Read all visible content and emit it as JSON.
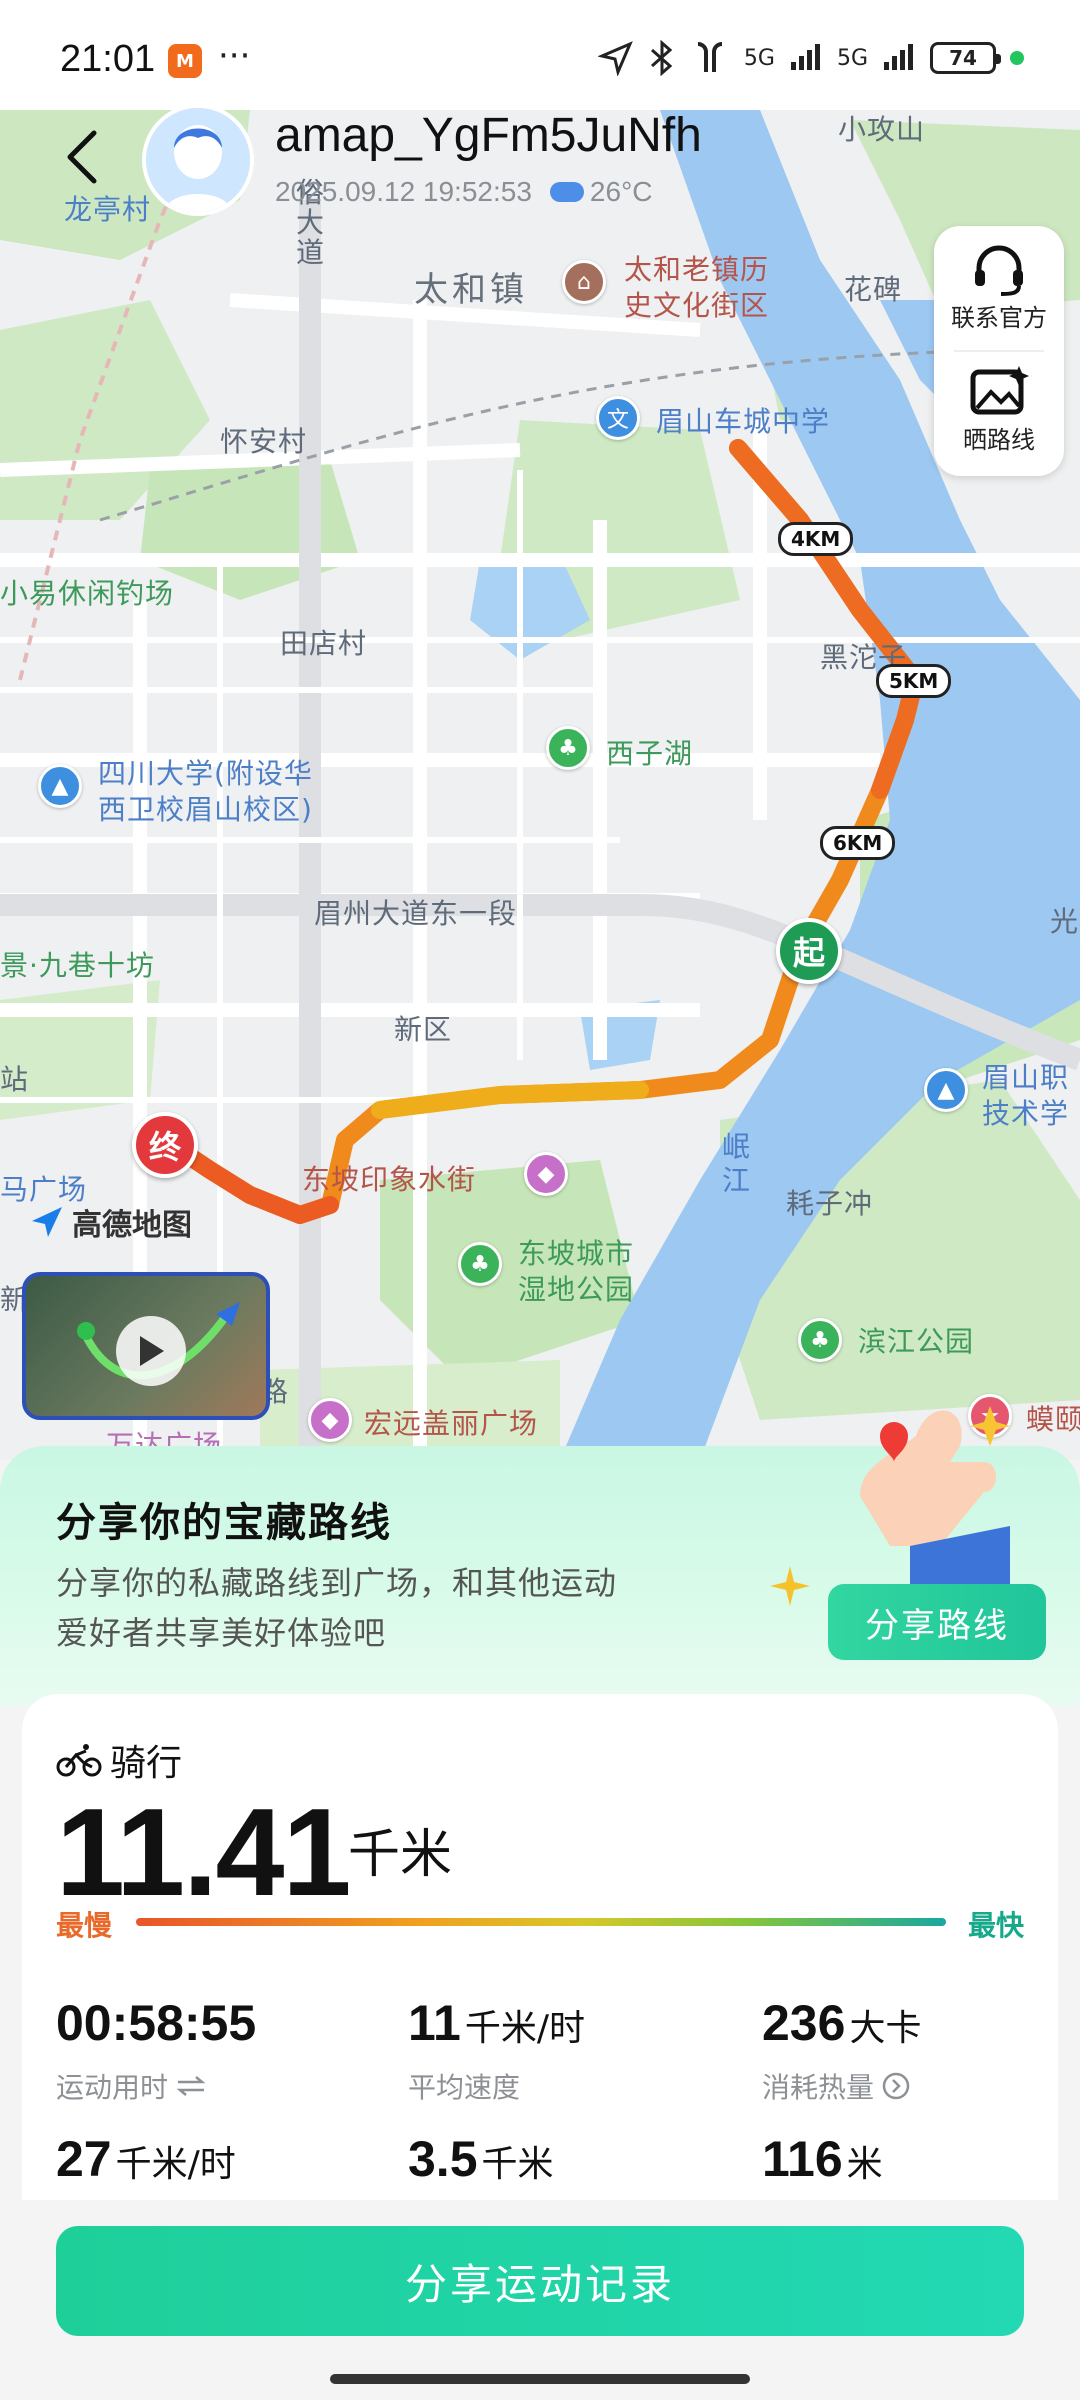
{
  "status_bar": {
    "time": "21:01",
    "app_badge": "M",
    "dots": "···",
    "signal1": "5G",
    "signal2": "5G",
    "battery": "74"
  },
  "header": {
    "username": "amap_YgFm5JuNfh",
    "datetime": "2025.09.12 19:52:53",
    "temperature": "26°C"
  },
  "side_card": {
    "contact_label": "联系官方",
    "share_route_label": "晒路线"
  },
  "map": {
    "labels": {
      "longting": "龙亭村",
      "xiaoyan": "小攻山",
      "yandadao": "俗大道",
      "taihe": "太和镇",
      "historic_1": "太和老镇历",
      "historic_2": "史文化街区",
      "huabei": "花碑",
      "huaian": "怀安村",
      "cheng_school": "眉山车城中学",
      "fishing": "小易休闲钓场",
      "tiandian": "田店村",
      "heitan": "黑沱子",
      "xizihu": "西子湖",
      "sichuan_1": "四川大学(附设华",
      "sichuan_2": "西卫校眉山校区)",
      "avenue": "眉州大道东一段",
      "jiuxiang": "景·九巷十坊",
      "xinqu": "新区",
      "guang": "光",
      "vocational_1": "眉山职",
      "vocational_2": "技术学",
      "shuijie": "东坡印象水街",
      "minjiang": "岷江",
      "haozichong": "耗子冲",
      "mag": "马广场",
      "dongpo_1": "东坡城市",
      "dongpo_2": "湿地公园",
      "binjiang": "滨江公园",
      "hongyuan": "宏远盖丽广场",
      "wanda": "万达广场",
      "mo": "蟆颐",
      "lu": "路",
      "zhan": "站",
      "xin": "新"
    },
    "markers": {
      "start": "起",
      "end": "终"
    },
    "km_tags": [
      "4KM",
      "5KM",
      "6KM"
    ],
    "brand": "高德地图"
  },
  "share_banner": {
    "title": "分享你的宝藏路线",
    "desc_line1": "分享你的私藏路线到广场，和其他运动",
    "desc_line2": "爱好者共享美好体验吧",
    "button_label": "分享路线"
  },
  "stats": {
    "activity": "骑行",
    "distance": "11.41",
    "distance_unit": "千米",
    "slow_label": "最慢",
    "fast_label": "最快",
    "items": [
      {
        "value": "00:58:55",
        "unit": "",
        "label": "运动用时"
      },
      {
        "value": "11",
        "unit": "千米/时",
        "label": "平均速度"
      },
      {
        "value": "236",
        "unit": "大卡",
        "label": "消耗热量"
      },
      {
        "value": "27",
        "unit": "千米/时",
        "label": ""
      },
      {
        "value": "3.5",
        "unit": "千米",
        "label": ""
      },
      {
        "value": "116",
        "unit": "米",
        "label": ""
      }
    ]
  },
  "bottom": {
    "share_record_label": "分享运动记录"
  },
  "colors": {
    "accent": "#20c59a",
    "route_orange": "#f08a1c",
    "river": "#9cc8f2",
    "park": "#bfe3b0"
  }
}
